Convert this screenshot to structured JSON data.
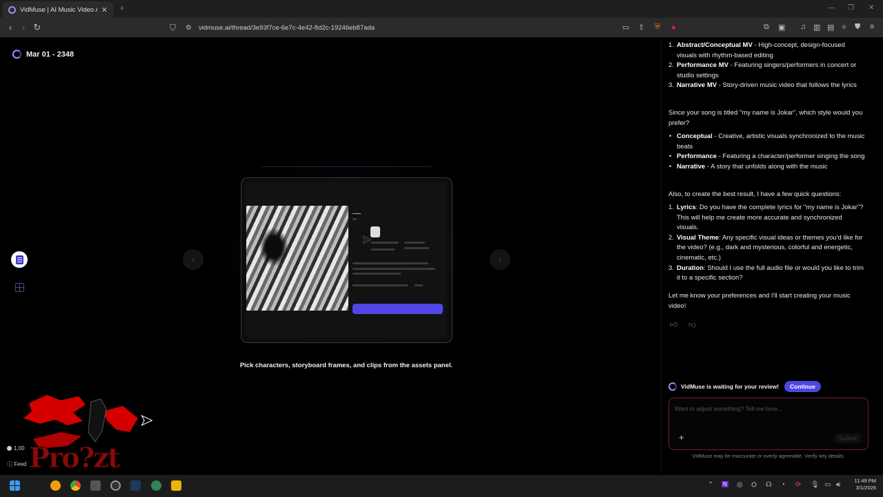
{
  "browser": {
    "tab_title": "VidMuse | AI Music Video Agent",
    "tab_close": "✕",
    "new_tab": "+",
    "url": "vidmuse.ai/thread/3e93f7ce-6e7c-4e42-8d2c-19246eb87ada"
  },
  "thread": {
    "title": "Mar 01 - 2348"
  },
  "main": {
    "caption": "Pick characters, storyboard frames, and clips from the assets panel."
  },
  "sidebar": {
    "credits": "1,00",
    "feedback": "Feed"
  },
  "overlay": {
    "text": "Pro?zt"
  },
  "chat": {
    "styles_list": [
      {
        "num": "1.",
        "name": "Abstract/Conceptual MV",
        "desc": " - High-concept, design-focused visuals with rhythm-based editing"
      },
      {
        "num": "2.",
        "name": "Performance MV",
        "desc": " - Featuring singers/performers in concert or studio settings"
      },
      {
        "num": "3.",
        "name": "Narrative MV",
        "desc": " - Story-driven music video that follows the lyrics"
      }
    ],
    "question": "Since your song is titled \"my name is Jokar\", which style would you prefer?",
    "options": [
      {
        "name": "Conceptual",
        "desc": " - Creative, artistic visuals synchronized to the music beats"
      },
      {
        "name": "Performance",
        "desc": " - Featuring a character/performer singing the song"
      },
      {
        "name": "Narrative",
        "desc": " - A story that unfolds along with the music"
      }
    ],
    "intro_questions": "Also, to create the best result, I have a few quick questions:",
    "questions": [
      {
        "num": "1.",
        "name": "Lyrics",
        "desc": ": Do you have the complete lyrics for \"my name is Jokar\"? This will help me create more accurate and synchronized visuals."
      },
      {
        "num": "2.",
        "name": "Visual Theme",
        "desc": ": Any specific visual ideas or themes you'd like for the video? (e.g., dark and mysterious, colorful and energetic, cinematic, etc.)"
      },
      {
        "num": "3.",
        "name": "Duration",
        "desc": ": Should I use the full audio file or would you like to trim it to a specific section?"
      }
    ],
    "closing": "Let me know your preferences and I'll start creating your music video!",
    "review_status": "VidMuse is waiting for your review!",
    "continue_label": "Continue",
    "input_placeholder": "Want to adjust something? Tell me here...",
    "plus_label": "+",
    "submit_label": "Submit",
    "disclaimer": "VidMuse may be inaccurate or overly agreeable. Verify key details."
  },
  "taskbar": {
    "time": "11:49 PM",
    "date": "3/1/2026"
  },
  "colors": {
    "accent": "#4f46e5",
    "spinner": "#a78bfa",
    "input_border": "#7a1c2c"
  }
}
